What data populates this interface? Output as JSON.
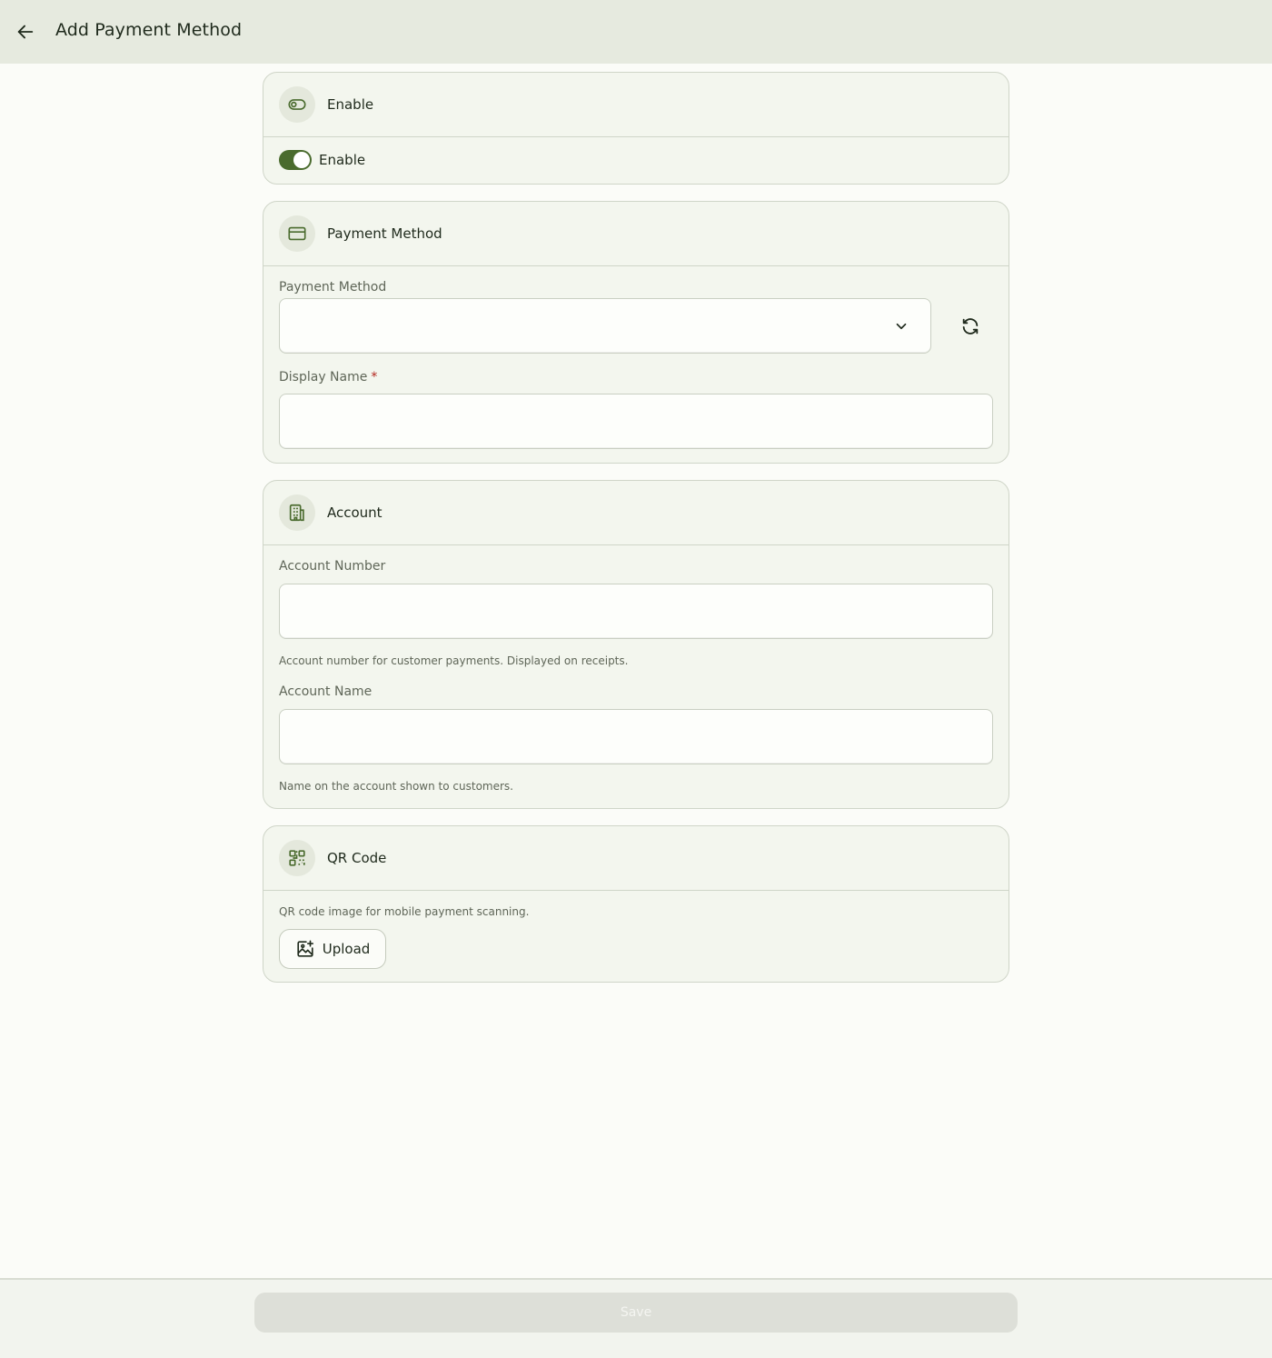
{
  "appbar": {
    "title": "Add Payment Method",
    "back_icon": "arrow-left-icon"
  },
  "enable_section": {
    "title": "Enable",
    "icon": "toggle-icon",
    "toggle_label": "Enable",
    "toggle_on": true,
    "accent": "#4a6b2e"
  },
  "payment_section": {
    "title": "Payment Method",
    "icon": "credit-card-icon",
    "method_label": "Payment Method",
    "method_value": "",
    "refresh_icon": "refresh-icon",
    "display_name_label": "Display Name",
    "display_name_required": "*",
    "display_name_value": ""
  },
  "account_section": {
    "title": "Account",
    "icon": "building-icon",
    "number_label": "Account Number",
    "number_value": "",
    "number_helper": "Account number for customer payments. Displayed on receipts.",
    "name_label": "Account Name",
    "name_value": "",
    "name_helper": "Name on the account shown to customers."
  },
  "qr_section": {
    "title": "QR Code",
    "icon": "qr-code-icon",
    "helper": "QR code image for mobile payment scanning.",
    "upload_label": "Upload",
    "upload_icon": "image-add-icon"
  },
  "footer": {
    "save_label": "Save",
    "save_enabled": false
  }
}
